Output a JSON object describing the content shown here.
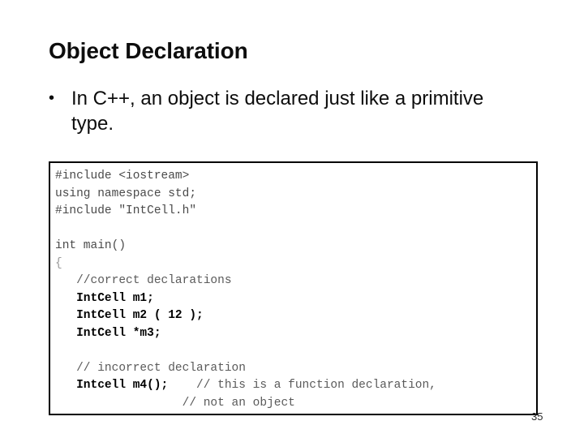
{
  "slide": {
    "title": "Object Declaration",
    "page_number": "35",
    "background_color": "#ffffff",
    "text_color": "#0d0d0d"
  },
  "bullets": [
    {
      "marker": "•",
      "text": "In C++, an object is declared just like a primitive type."
    }
  ],
  "code_box": {
    "border_color": "#000000",
    "background_color": "#ffffff",
    "lines": [
      {
        "id": "line-1",
        "segments": [
          {
            "style": "plain",
            "text": "#include <iostream>"
          }
        ]
      },
      {
        "id": "line-2",
        "segments": [
          {
            "style": "plain",
            "text": "using namespace std;"
          }
        ]
      },
      {
        "id": "line-3",
        "segments": [
          {
            "style": "plain",
            "text": "#include \"IntCell.h\""
          }
        ]
      },
      {
        "id": "line-4",
        "segments": [
          {
            "style": "plain",
            "text": ""
          }
        ]
      },
      {
        "id": "line-5",
        "segments": [
          {
            "style": "plain",
            "text": "int main()"
          }
        ]
      },
      {
        "id": "line-6",
        "segments": [
          {
            "style": "brace",
            "text": "{"
          }
        ]
      },
      {
        "id": "line-7",
        "segments": [
          {
            "style": "comment",
            "text": "   //correct declarations"
          }
        ]
      },
      {
        "id": "line-8",
        "segments": [
          {
            "style": "decl",
            "text": "   IntCell m1;"
          }
        ]
      },
      {
        "id": "line-9",
        "segments": [
          {
            "style": "decl",
            "text": "   IntCell m2 ( 12 );"
          }
        ]
      },
      {
        "id": "line-10",
        "segments": [
          {
            "style": "decl",
            "text": "   IntCell *m3;"
          }
        ]
      },
      {
        "id": "line-11",
        "segments": [
          {
            "style": "plain",
            "text": ""
          }
        ]
      },
      {
        "id": "line-12",
        "segments": [
          {
            "style": "comment",
            "text": "   // incorrect declaration"
          }
        ]
      },
      {
        "id": "line-13",
        "segments": [
          {
            "style": "decl",
            "text": "   Intcell m4();"
          },
          {
            "style": "comment",
            "text": "    // this is a function declaration,"
          }
        ]
      },
      {
        "id": "line-14",
        "segments": [
          {
            "style": "comment",
            "text": "                  // not an object"
          }
        ]
      }
    ]
  }
}
